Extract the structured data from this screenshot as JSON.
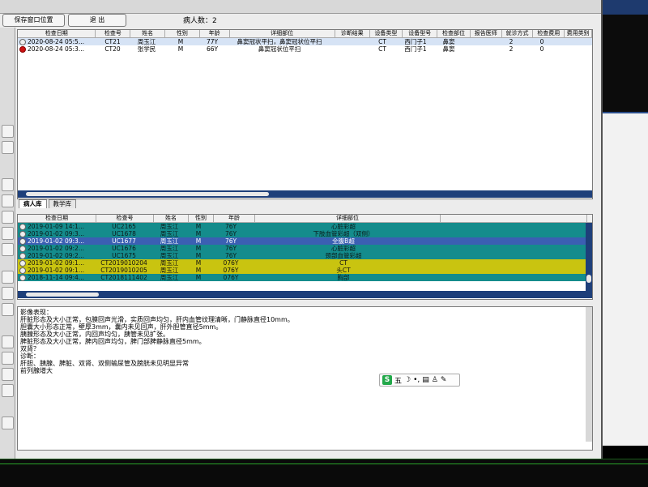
{
  "toolbar": {
    "save_pos_label": "保存窗口位置",
    "exit_label": "退 出",
    "patient_count": "病人数：2"
  },
  "top_table": {
    "columns": [
      "检查日期",
      "检查号",
      "姓名",
      "性别",
      "年龄",
      "详细部位",
      "诊断结果",
      "设备类型",
      "设备型号",
      "检查部位",
      "报告医师",
      "就诊方式",
      "检查费用",
      "费用类别"
    ],
    "rows": [
      {
        "date": "2020-08-24 05:5...",
        "id": "CT21",
        "name": "周玉江",
        "sex": "M",
        "age": "77Y",
        "detail": "鼻窦冠状平扫，鼻窦冠状位平扫",
        "result": "",
        "device": "CT",
        "model": "西门子1",
        "part": "鼻窦",
        "doctor": "",
        "visit": "2",
        "fee": "0",
        "icon": "status-normal-icon"
      },
      {
        "date": "2020-08-24 05:3...",
        "id": "CT20",
        "name": "张学民",
        "sex": "M",
        "age": "66Y",
        "detail": "鼻窦冠状位平扫",
        "result": "",
        "device": "CT",
        "model": "西门子1",
        "part": "鼻窦",
        "doctor": "",
        "visit": "2",
        "fee": "0",
        "icon": "status-red-icon"
      }
    ]
  },
  "tabs": [
    "病人库",
    "教学库"
  ],
  "bottom_table": {
    "columns": [
      "检查日期",
      "检查号",
      "姓名",
      "性别",
      "年龄",
      "详细部位"
    ],
    "rows": [
      {
        "date": "2019-01-09 14:1...",
        "id": "UC2165",
        "name": "周玉江",
        "sex": "M",
        "age": "76Y",
        "detail": "心脏彩超",
        "color": "teal"
      },
      {
        "date": "2019-01-02 09:3...",
        "id": "UC1678",
        "name": "周玉江",
        "sex": "M",
        "age": "76Y",
        "detail": "下肢血管彩超（双侧）",
        "color": "teal"
      },
      {
        "date": "2019-01-02 09:3...",
        "id": "UC1677",
        "name": "周玉江",
        "sex": "M",
        "age": "76Y",
        "detail": "全腹B超",
        "color": "blue"
      },
      {
        "date": "2019-01-02 09:2...",
        "id": "UC1676",
        "name": "周玉江",
        "sex": "M",
        "age": "76Y",
        "detail": "心脏彩超",
        "color": "teal"
      },
      {
        "date": "2019-01-02 09:2...",
        "id": "UC1675",
        "name": "周玉江",
        "sex": "M",
        "age": "76Y",
        "detail": "颈部血管彩超",
        "color": "teal"
      },
      {
        "date": "2019-01-02 09:1...",
        "id": "CT2019010204",
        "name": "周玉江",
        "sex": "M",
        "age": "076Y",
        "detail": "CT",
        "color": "yellow"
      },
      {
        "date": "2019-01-02 09:1...",
        "id": "CT2019010205",
        "name": "周玉江",
        "sex": "M",
        "age": "076Y",
        "detail": "头CT",
        "color": "yellow"
      },
      {
        "date": "2018-11-14 09:4...",
        "id": "CT2018111402",
        "name": "周玉江",
        "sex": "M",
        "age": "076Y",
        "detail": "胸部",
        "color": "teal"
      }
    ]
  },
  "report": {
    "lines": [
      "影像表现：",
      "肝脏形态及大小正常，包膜回声光滑，实质回声均匀，肝内血管纹理清晰，门静脉直径10mm。",
      "胆囊大小形态正常，壁厚3mm，囊内未见回声，肝外胆管直径5mm。",
      "胰腺形态及大小正常，内回声均匀，胰管未见扩张。",
      "脾脏形态及大小正常，脾内回声均匀，脾门部脾静脉直径5mm。",
      "双肾？",
      "诊断：",
      "肝胆、胰腺、脾脏、双肾、双侧输尿管及膀胱未见明显异常",
      "前列腺增大"
    ]
  },
  "ime": {
    "logo": "S",
    "mode": "五"
  }
}
